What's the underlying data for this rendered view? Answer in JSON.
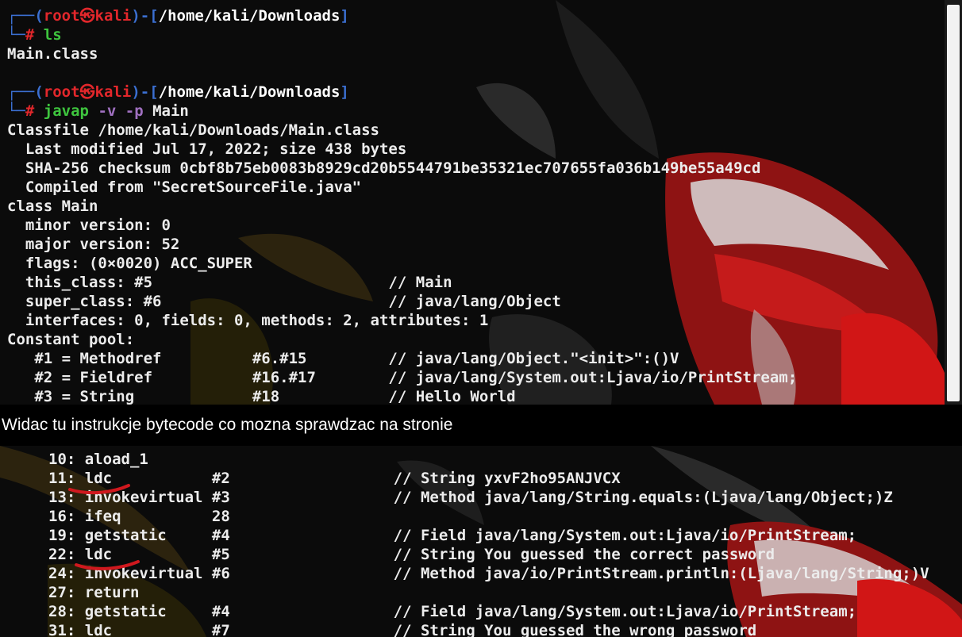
{
  "colors": {
    "bracket": "#3b6fd1",
    "root": "#e2272b",
    "command": "#3ec43e",
    "flag": "#a070c0",
    "annotation": "#d0181e"
  },
  "icons": [
    "kali-dragon-icon"
  ],
  "top": {
    "p1": {
      "corner": "┌──(",
      "user": "root",
      "at": "㉿",
      "host": "kali",
      "mid": ")-[",
      "path": "/home/kali/Downloads",
      "end": "]",
      "corner2": "└─",
      "hash": "#",
      "cmd": "ls",
      "args1": "",
      "args2": ""
    },
    "out1": "Main.class",
    "p2": {
      "corner": "┌──(",
      "user": "root",
      "at": "㉿",
      "host": "kali",
      "mid": ")-[",
      "path": "/home/kali/Downloads",
      "end": "]",
      "corner2": "└─",
      "hash": "#",
      "cmd": "javap",
      "flags": "-v -p",
      "arg": "Main"
    },
    "lines": [
      "Classfile /home/kali/Downloads/Main.class",
      "  Last modified Jul 17, 2022; size 438 bytes",
      "  SHA-256 checksum 0cbf8b75eb0083b8929cd20b5544791be35321ec707655fa036b149be55a49cd",
      "  Compiled from \"SecretSourceFile.java\"",
      "class Main",
      "  minor version: 0",
      "  major version: 52",
      "  flags: (0×0020) ACC_SUPER",
      "  this_class: #5                          // Main",
      "  super_class: #6                         // java/lang/Object",
      "  interfaces: 0, fields: 0, methods: 2, attributes: 1",
      "Constant pool:",
      "   #1 = Methodref          #6.#15         // java/lang/Object.\"<init>\":()V",
      "   #2 = Fieldref           #16.#17        // java/lang/System.out:Ljava/io/PrintStream;",
      "   #3 = String             #18            // Hello World"
    ]
  },
  "caption": "Widac tu instrukcje bytecode co mozna sprawdzac na stronie",
  "bottom": {
    "lines": [
      "10: aload_1",
      "11: ldc           #2                  // String yxvF2ho95ANJVCX",
      "13: invokevirtual #3                  // Method java/lang/String.equals:(Ljava/lang/Object;)Z",
      "16: ifeq          28",
      "19: getstatic     #4                  // Field java/lang/System.out:Ljava/io/PrintStream;",
      "22: ldc           #5                  // String You guessed the correct password",
      "24: invokevirtual #6                  // Method java/io/PrintStream.println:(Ljava/lang/String;)V",
      "27: return",
      "28: getstatic     #4                  // Field java/lang/System.out:Ljava/io/PrintStream;",
      "31: ldc           #7                  // String You guessed the wrong password"
    ]
  }
}
